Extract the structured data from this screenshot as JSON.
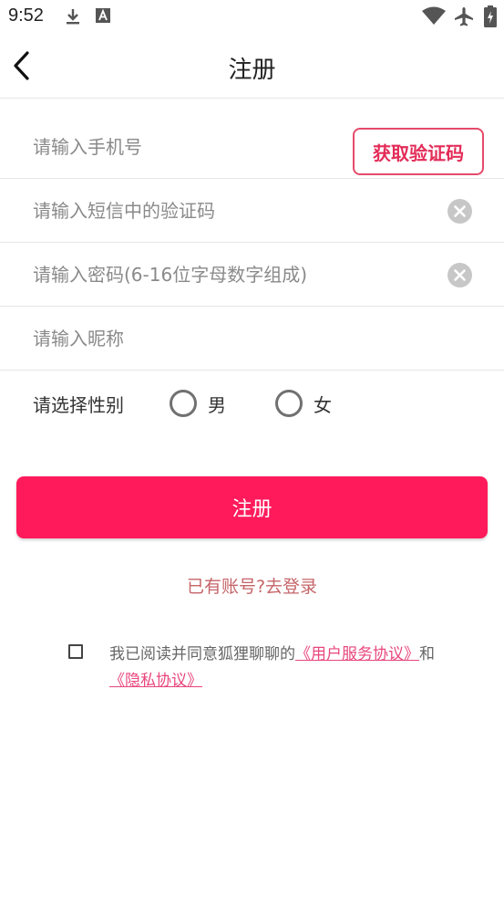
{
  "status_bar": {
    "time": "9:52",
    "icons": [
      "download-icon",
      "font-icon",
      "wifi-icon",
      "airplane-icon",
      "battery-charging-icon"
    ]
  },
  "header": {
    "title": "注册",
    "back_icon": "chevron-left-icon"
  },
  "form": {
    "phone_placeholder": "请输入手机号",
    "get_code_label": "获取验证码",
    "sms_code_placeholder": "请输入短信中的验证码",
    "password_placeholder": "请输入密码(6-16位字母数字组成)",
    "nickname_placeholder": "请输入昵称",
    "gender_label": "请选择性别",
    "gender_options": [
      {
        "label": "男",
        "selected": false
      },
      {
        "label": "女",
        "selected": false
      }
    ],
    "clear_icon": "clear-circle-icon"
  },
  "register_button_label": "注册",
  "login_link": "已有账号?去登录",
  "agreement": {
    "checked": false,
    "prefix": "我已阅读并同意狐狸聊聊的",
    "service_link": "《用户服务协议》",
    "conjunction": "和",
    "privacy_link": "《隐私协议》"
  },
  "colors": {
    "accent": "#ff1a5b",
    "code_button_border": "#e54b6a",
    "login_link": "#c56468",
    "agreement_link": "#e8467c"
  }
}
